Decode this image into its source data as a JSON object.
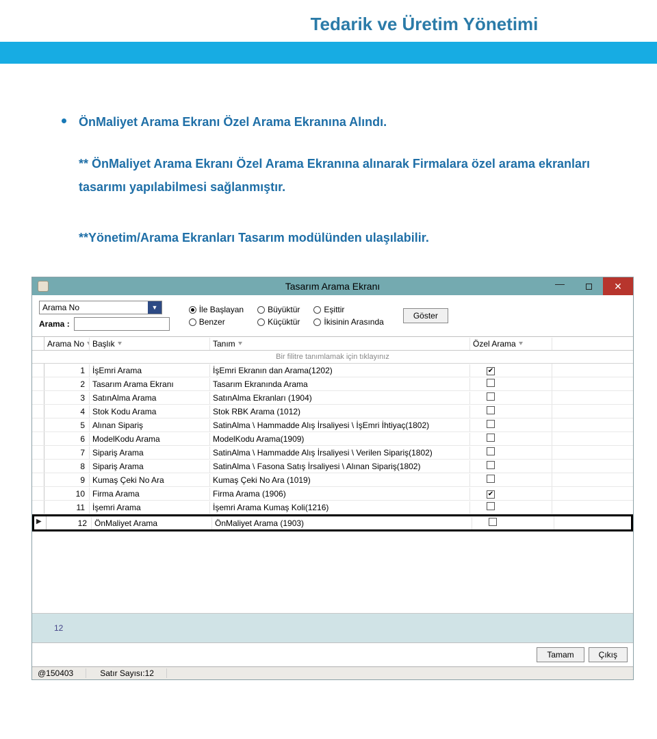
{
  "pageTitle": "Tedarik ve Üretim Yönetimi",
  "bullet": "ÖnMaliyet Arama Ekranı Özel Arama Ekranına Alındı.",
  "note1": "** ÖnMaliyet Arama Ekranı Özel Arama Ekranına alınarak  Firmalara özel arama ekranları tasarımı yapılabilmesi  sağlanmıştır.",
  "note2": "**Yönetim/Arama Ekranları Tasarım  modülünden ulaşılabilir.",
  "window": {
    "title": "Tasarım Arama Ekranı",
    "combo": "Arama No",
    "aramaLabel": "Arama :",
    "radios": [
      "İle Başlayan",
      "Büyüktür",
      "Eşittir",
      "Benzer",
      "Küçüktür",
      "İkisinin Arasında"
    ],
    "radioSelected": 0,
    "gosterBtn": "Göster",
    "columns": [
      "Arama No",
      "Başlık",
      "Tanım",
      "Özel Arama"
    ],
    "filterPlaceholder": "Bir filitre tanımlamak için tıklayınız",
    "rows": [
      {
        "no": "1",
        "baslik": "İşEmri Arama",
        "tanim": "İşEmri Ekranın dan Arama(1202)",
        "ozel": true
      },
      {
        "no": "2",
        "baslik": "Tasarım Arama Ekranı",
        "tanim": "Tasarım Ekranında Arama",
        "ozel": false
      },
      {
        "no": "3",
        "baslik": "SatınAlma Arama",
        "tanim": "SatınAlma Ekranları (1904)",
        "ozel": false
      },
      {
        "no": "4",
        "baslik": "Stok Kodu Arama",
        "tanim": "Stok RBK Arama (1012)",
        "ozel": false
      },
      {
        "no": "5",
        "baslik": "Alınan Sipariş",
        "tanim": "SatinAlma \\ Hammadde Alış İrsaliyesi \\ İşEmri İhtiyaç(1802)",
        "ozel": false
      },
      {
        "no": "6",
        "baslik": "ModelKodu Arama",
        "tanim": "ModelKodu Arama(1909)",
        "ozel": false
      },
      {
        "no": "7",
        "baslik": "Sipariş Arama",
        "tanim": "SatinAlma \\ Hammadde Alış İrsaliyesi \\ Verilen Sipariş(1802)",
        "ozel": false
      },
      {
        "no": "8",
        "baslik": "Sipariş Arama",
        "tanim": "SatinAlma \\ Fasona Satış İrsaliyesi \\ Alınan Sipariş(1802)",
        "ozel": false
      },
      {
        "no": "9",
        "baslik": "Kumaş Çeki No Ara",
        "tanim": "Kumaş Çeki No Ara (1019)",
        "ozel": false
      },
      {
        "no": "10",
        "baslik": "Firma Arama",
        "tanim": "Firma Arama (1906)",
        "ozel": true
      },
      {
        "no": "11",
        "baslik": "İşemri Arama",
        "tanim": "İşemri Arama Kumaş Koli(1216)",
        "ozel": false
      },
      {
        "no": "12",
        "baslik": "ÖnMaliyet Arama",
        "tanim": "ÖnMaliyet Arama (1903)",
        "ozel": false,
        "highlight": true,
        "caret": true
      }
    ],
    "pager": "12",
    "tamamBtn": "Tamam",
    "cikisBtn": "Çıkış",
    "statusLeft": "@150403",
    "statusCount": "Satır Sayısı:12"
  }
}
